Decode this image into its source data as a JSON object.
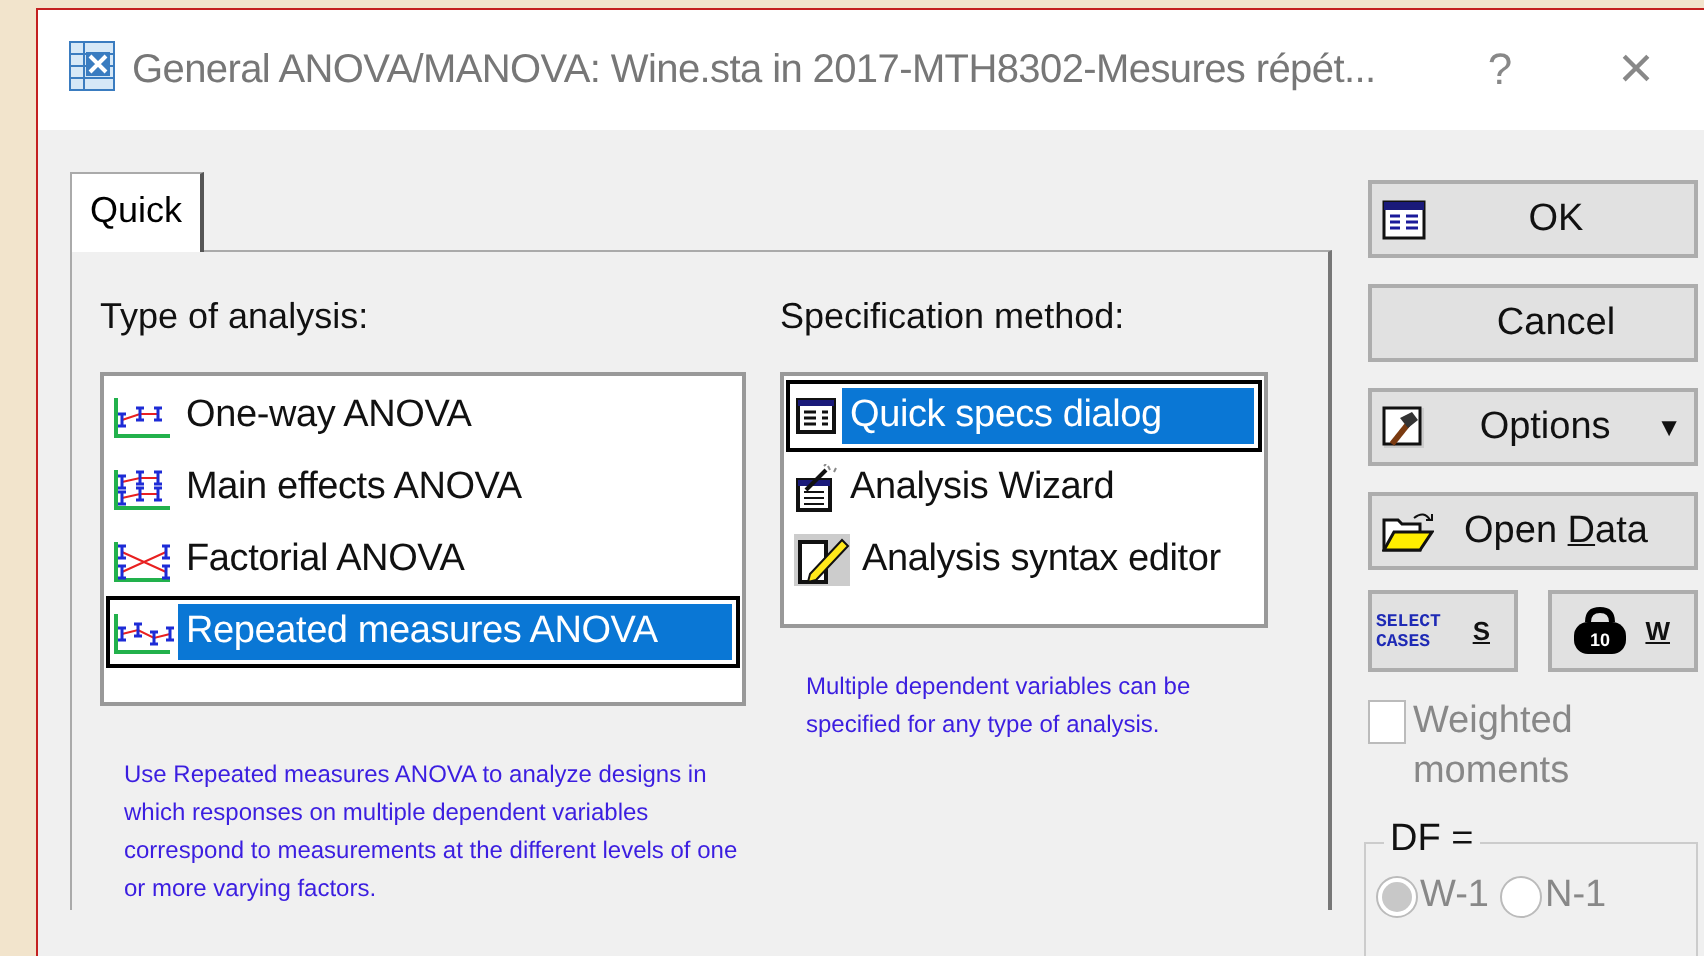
{
  "window": {
    "title": "General ANOVA/MANOVA: Wine.sta in 2017-MTH8302-Mesures répét...",
    "help": "?",
    "close": "×"
  },
  "tabs": [
    {
      "label": "Quick",
      "selected": true
    }
  ],
  "analysis_type": {
    "label": "Type of analysis:",
    "items": [
      {
        "label": "One-way ANOVA",
        "kind": "oneway",
        "selected": false
      },
      {
        "label": "Main effects ANOVA",
        "kind": "main",
        "selected": false
      },
      {
        "label": "Factorial ANOVA",
        "kind": "factorial",
        "selected": false
      },
      {
        "label": "Repeated measures ANOVA",
        "kind": "repeated",
        "selected": true
      }
    ],
    "note": "Use Repeated measures ANOVA to analyze designs in which responses on multiple dependent variables correspond to measurements at the different levels of one or more varying factors."
  },
  "specification_method": {
    "label": "Specification method:",
    "items": [
      {
        "label": "Quick specs dialog",
        "kind": "quick",
        "selected": true
      },
      {
        "label": "Analysis Wizard",
        "kind": "wizard",
        "selected": false
      },
      {
        "label": "Analysis syntax editor",
        "kind": "syntax",
        "selected": false
      }
    ],
    "note": "Multiple dependent variables can be specified for any type of analysis."
  },
  "buttons": [
    {
      "kind": "ok",
      "label": "OK"
    },
    {
      "kind": "plain",
      "label": "Cancel"
    },
    {
      "kind": "options",
      "label": "Options",
      "caret": "▼"
    },
    {
      "kind": "open",
      "label": "Open Data",
      "mnemonic_underlined": true
    }
  ],
  "small_buttons": [
    {
      "kind": "select",
      "badge": "SELECT CASES",
      "label": "S"
    },
    {
      "kind": "weight",
      "badge": "10",
      "label": "W"
    }
  ],
  "weighted_moments": {
    "label": "Weighted moments",
    "checked": false,
    "disabled": true
  },
  "df": {
    "label": "DF =",
    "disabled": true,
    "options": [
      {
        "label": "W-1",
        "selected": true
      },
      {
        "label": "N-1",
        "selected": false
      }
    ]
  }
}
